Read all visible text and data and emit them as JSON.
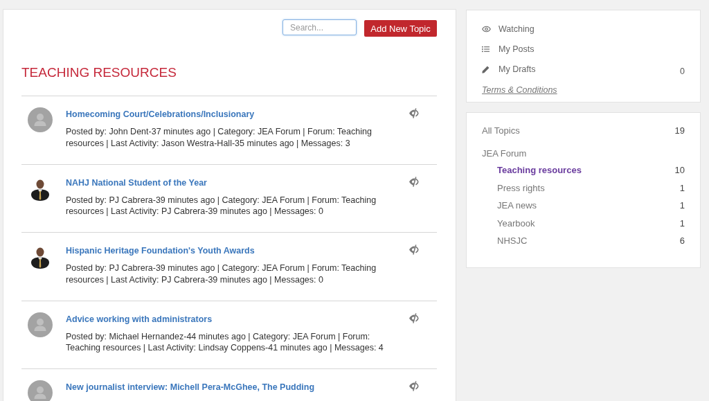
{
  "toolbar": {
    "search": {
      "placeholder": "Search..."
    },
    "add_button": "Add New Topic"
  },
  "heading": "TEACHING RESOURCES",
  "topics": [
    {
      "kind": "default",
      "title": "Homecoming Court/Celebrations/Inclusionary",
      "meta": "Posted by: John Dent-37 minutes ago | Category: JEA Forum | Forum: Teaching resources | Last Activity: Jason Westra-Hall-35 minutes ago | Messages: 3",
      "watched": false
    },
    {
      "kind": "photo",
      "title": "NAHJ National Student of the Year",
      "meta": "Posted by: PJ Cabrera-39 minutes ago | Category: JEA Forum | Forum: Teaching resources | Last Activity: PJ Cabrera-39 minutes ago | Messages: 0",
      "watched": false
    },
    {
      "kind": "photo",
      "title": "Hispanic Heritage Foundation's Youth Awards",
      "meta": "Posted by: PJ Cabrera-39 minutes ago | Category: JEA Forum | Forum: Teaching resources | Last Activity: PJ Cabrera-39 minutes ago | Messages: 0",
      "watched": false
    },
    {
      "kind": "default",
      "title": "Advice working with administrators",
      "meta": "Posted by: Michael Hernandez-44 minutes ago | Category: JEA Forum | Forum: Teaching resources | Last Activity: Lindsay Coppens-41 minutes ago | Messages: 4",
      "watched": false
    },
    {
      "kind": "default",
      "title": "New journalist interview: Michell Pera-McGhee, The Pudding",
      "watched": false
    }
  ],
  "my_links": {
    "items": [
      {
        "kind": "watching",
        "label": "Watching"
      },
      {
        "kind": "posts",
        "label": "My Posts"
      },
      {
        "kind": "drafts",
        "label": "My Drafts",
        "count": "0"
      }
    ],
    "terms_link": "Terms & Conditions"
  },
  "forum_nav": [
    {
      "label": "All Topics",
      "count": "19",
      "selected": false
    },
    {
      "label": "JEA Forum",
      "selected": false,
      "children": [
        {
          "label": "Teaching resources",
          "count": "10",
          "selected": true
        },
        {
          "label": "Press rights",
          "count": "1",
          "selected": false
        },
        {
          "label": "JEA news",
          "count": "1",
          "selected": false
        },
        {
          "label": "Yearbook",
          "count": "1",
          "selected": false
        },
        {
          "label": "NHSJC",
          "count": "6",
          "selected": false
        }
      ]
    }
  ]
}
